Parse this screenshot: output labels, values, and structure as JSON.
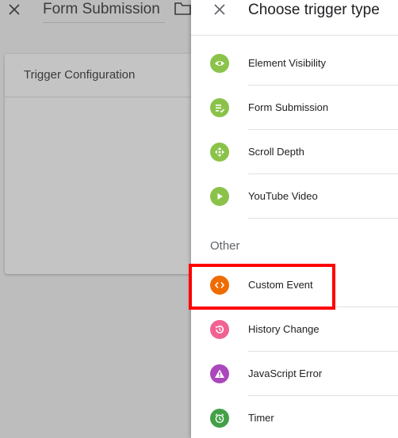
{
  "background": {
    "title": "Form Submission",
    "card_title": "Trigger Configuration"
  },
  "panel": {
    "title": "Choose trigger type",
    "items_top": [
      {
        "label": "Element Visibility",
        "icon": "eye-icon",
        "color": "#8bc34a"
      },
      {
        "label": "Form Submission",
        "icon": "form-icon",
        "color": "#8bc34a"
      },
      {
        "label": "Scroll Depth",
        "icon": "scroll-icon",
        "color": "#8bc34a"
      },
      {
        "label": "YouTube Video",
        "icon": "play-icon",
        "color": "#8bc34a"
      }
    ],
    "section_other": "Other",
    "items_other": [
      {
        "label": "Custom Event",
        "icon": "code-icon",
        "color": "#ef6c00"
      },
      {
        "label": "History Change",
        "icon": "history-icon",
        "color": "#f06292"
      },
      {
        "label": "JavaScript Error",
        "icon": "warning-icon",
        "color": "#ab47bc"
      },
      {
        "label": "Timer",
        "icon": "timer-icon",
        "color": "#43a047"
      }
    ]
  },
  "colors": {
    "highlight": "#ff0000"
  }
}
